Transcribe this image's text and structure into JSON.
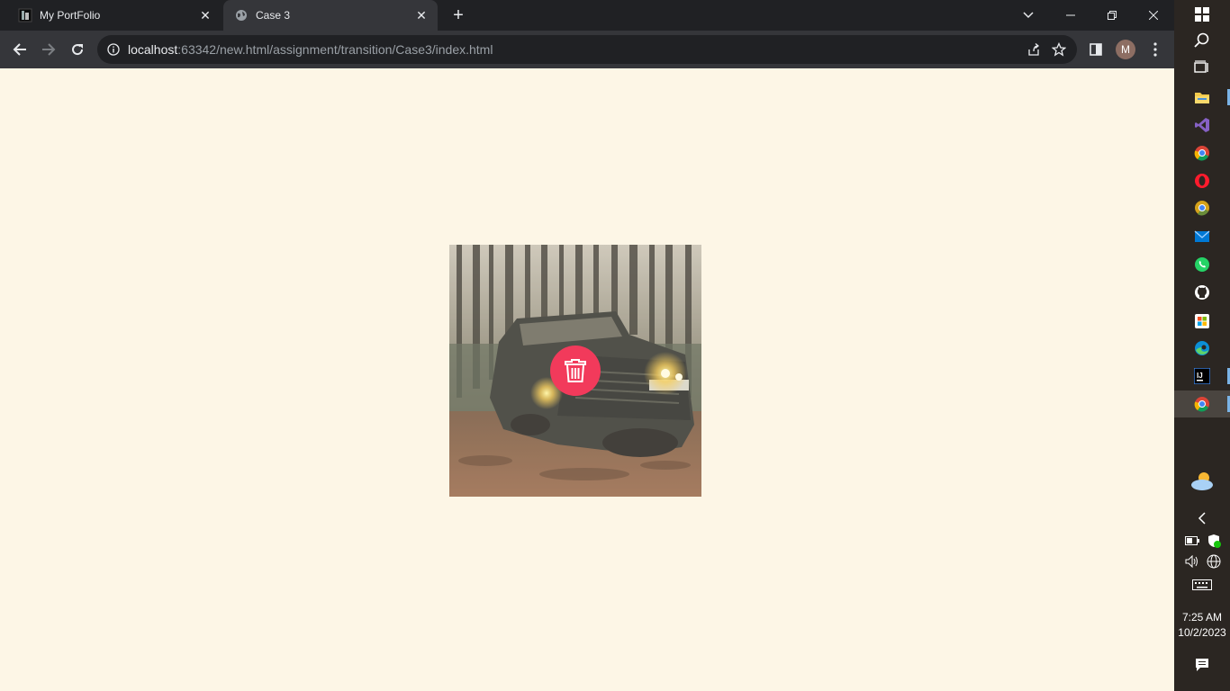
{
  "browser": {
    "tabs": [
      {
        "title": "My PortFolio",
        "active": false
      },
      {
        "title": "Case 3",
        "active": true
      }
    ],
    "new_tab_symbol": "+",
    "address": {
      "host": "localhost",
      "path": ":63342/new.html/assignment/transition/Case3/index.html"
    },
    "profile_initial": "M"
  },
  "page": {
    "background": "#fdf6e6",
    "card": {
      "image_subject": "muddy off-road jeep in a forest with headlights on",
      "overlay_button": {
        "icon": "trash-icon",
        "color": "#f23a5b"
      }
    }
  },
  "taskbar": {
    "time": "7:25 AM",
    "date": "10/2/2023"
  }
}
